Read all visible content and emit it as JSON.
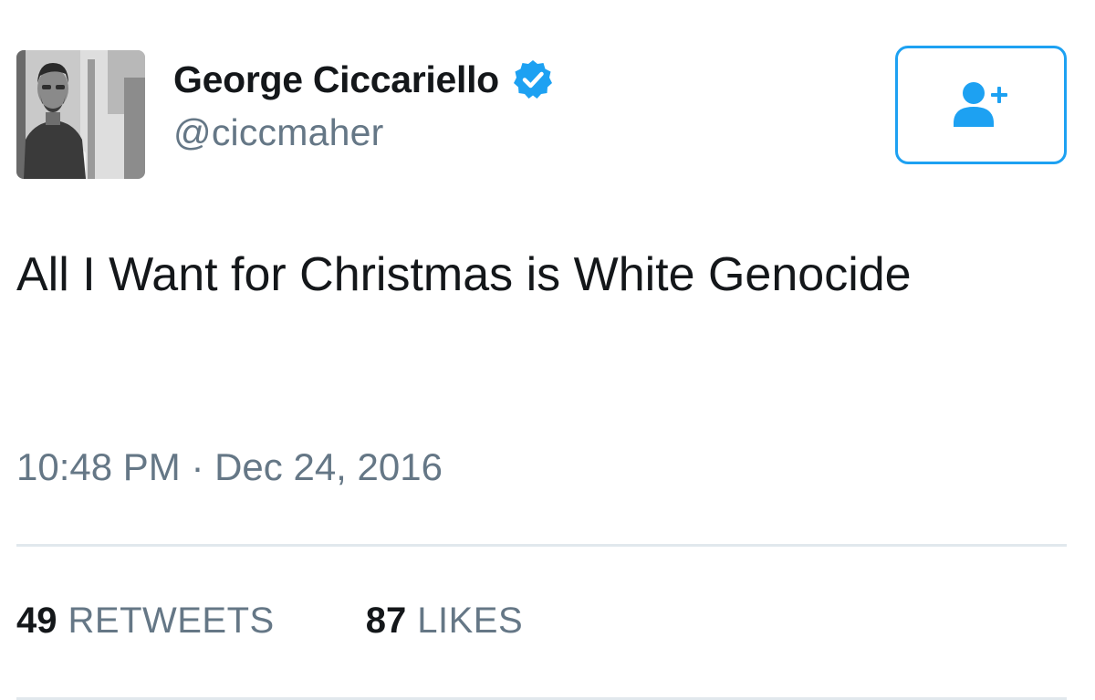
{
  "author": {
    "display_name": "George Ciccariello",
    "handle": "@ciccmaher",
    "verified": true
  },
  "follow_button": {
    "icon": "add-user-icon"
  },
  "tweet": {
    "text": "All I Want for Christmas is White Genocide",
    "timestamp": "10:48 PM · Dec 24, 2016"
  },
  "stats": {
    "retweets": {
      "count": "49",
      "label": "RETWEETS"
    },
    "likes": {
      "count": "87",
      "label": "LIKES"
    }
  },
  "colors": {
    "accent": "#1da1f2",
    "text": "#14171a",
    "secondary_text": "#657786",
    "divider": "#e1e8ed"
  }
}
